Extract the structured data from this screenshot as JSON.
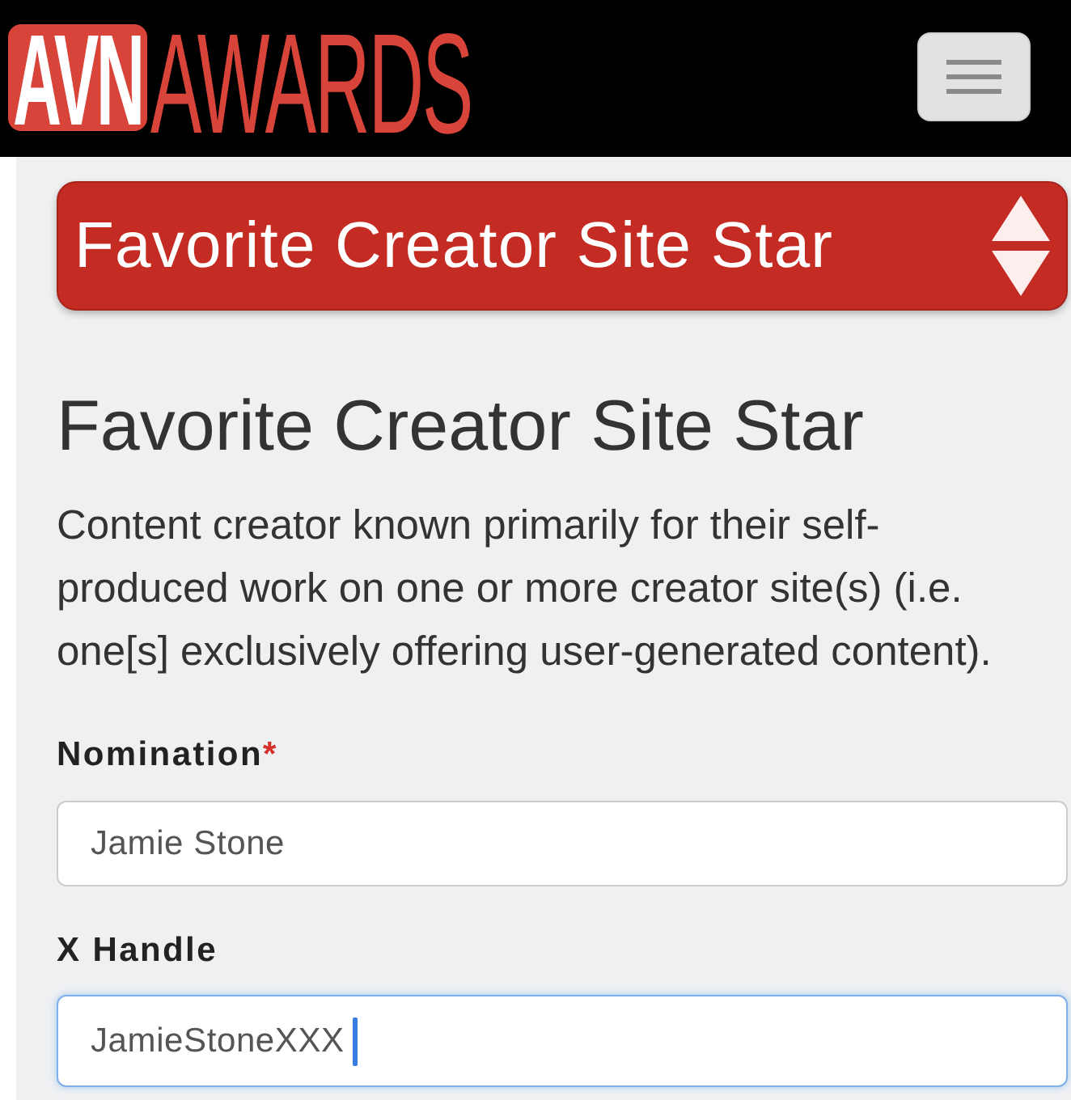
{
  "header": {
    "logo": {
      "badge": "AVN",
      "wordmark": "AWARDS"
    }
  },
  "category_select": {
    "value": "Favorite Creator Site Star"
  },
  "category": {
    "title": "Favorite Creator Site Star",
    "description": "Content creator known primarily for their self-produced work on one or more creator site(s) (i.e. one[s] exclusively offering user-generated content)."
  },
  "fields": [
    {
      "label": "Nomination",
      "required_mark": "*",
      "value": "Jamie Stone",
      "focused": false
    },
    {
      "label": "X Handle",
      "value": "JamieStoneXXX",
      "focused": true
    }
  ]
}
